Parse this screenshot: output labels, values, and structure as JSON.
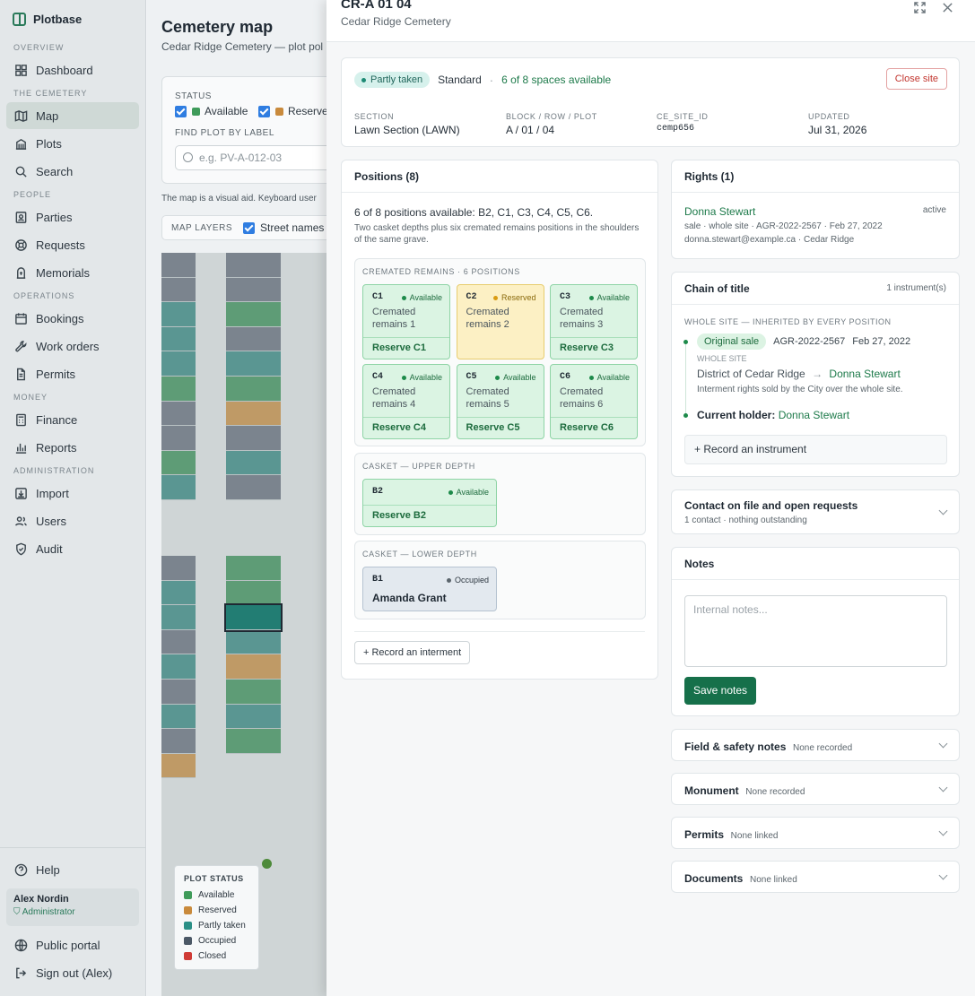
{
  "app": {
    "name": "Plotbase"
  },
  "sidebar": {
    "sections": [
      {
        "label": "OVERVIEW",
        "items": [
          {
            "label": "Dashboard",
            "icon": "grid-icon"
          }
        ]
      },
      {
        "label": "THE CEMETERY",
        "items": [
          {
            "label": "Map",
            "icon": "map-icon",
            "active": true
          },
          {
            "label": "Plots",
            "icon": "building-icon"
          },
          {
            "label": "Search",
            "icon": "search-icon"
          }
        ]
      },
      {
        "label": "PEOPLE",
        "items": [
          {
            "label": "Parties",
            "icon": "contact-icon"
          },
          {
            "label": "Requests",
            "icon": "lifebuoy-icon"
          },
          {
            "label": "Memorials",
            "icon": "memorial-icon"
          }
        ]
      },
      {
        "label": "OPERATIONS",
        "items": [
          {
            "label": "Bookings",
            "icon": "calendar-icon"
          },
          {
            "label": "Work orders",
            "icon": "wrench-icon"
          },
          {
            "label": "Permits",
            "icon": "file-icon"
          }
        ]
      },
      {
        "label": "MONEY",
        "items": [
          {
            "label": "Finance",
            "icon": "calculator-icon"
          },
          {
            "label": "Reports",
            "icon": "bar-chart-icon"
          }
        ]
      },
      {
        "label": "ADMINISTRATION",
        "items": [
          {
            "label": "Import",
            "icon": "import-icon"
          },
          {
            "label": "Users",
            "icon": "users-icon"
          },
          {
            "label": "Audit",
            "icon": "shield-icon"
          }
        ]
      }
    ],
    "help": "Help",
    "user": {
      "name": "Alex Nordin",
      "role": "Administrator"
    },
    "public_portal": "Public portal",
    "sign_out": "Sign out (Alex)"
  },
  "main": {
    "title": "Cemetery map",
    "subtitle": "Cedar Ridge Cemetery — plot pol",
    "status_label": "STATUS",
    "status_available": "Available",
    "status_reserved": "Reserve",
    "find_label": "FIND PLOT BY LABEL",
    "find_placeholder": "e.g. PV-A-012-03",
    "hint": "The map is a visual aid. Keyboard user",
    "layers_label": "MAP LAYERS",
    "layers_street": "Street names",
    "legend": {
      "title": "PLOT STATUS",
      "items": [
        {
          "label": "Available",
          "color": "#3f9b5a"
        },
        {
          "label": "Reserved",
          "color": "#c98a3c"
        },
        {
          "label": "Partly taken",
          "color": "#2a8f86"
        },
        {
          "label": "Occupied",
          "color": "#4b5866"
        },
        {
          "label": "Closed",
          "color": "#cf3b36"
        }
      ]
    }
  },
  "drawer": {
    "title": "CR-A 01 04",
    "subtitle": "Cedar Ridge Cemetery",
    "summary": {
      "status_badge": "Partly taken",
      "tier": "Standard",
      "availability": "6 of 8 spaces available",
      "close_site": "Close site",
      "section_label": "SECTION",
      "section_value": "Lawn Section (LAWN)",
      "brp_label": "BLOCK / ROW / PLOT",
      "brp_value": "A / 01 / 04",
      "ce_label": "CE_SITE_ID",
      "ce_value": "cemp656",
      "updated_label": "UPDATED",
      "updated_value": "Jul 31, 2026"
    },
    "positions": {
      "title": "Positions (8)",
      "available_text": "6 of 8 positions available: B2, C1, C3, C4, C5, C6.",
      "explain": "Two casket depths plus six cremated remains positions in the shoulders of the same grave.",
      "cremated_label": "CREMATED REMAINS · 6 POSITIONS",
      "cremated": [
        {
          "code": "C1",
          "status": "Available",
          "desc": "Cremated remains 1",
          "action": "Reserve C1"
        },
        {
          "code": "C2",
          "status": "Reserved",
          "desc": "Cremated remains 2",
          "action": ""
        },
        {
          "code": "C3",
          "status": "Available",
          "desc": "Cremated remains 3",
          "action": "Reserve C3"
        },
        {
          "code": "C4",
          "status": "Available",
          "desc": "Cremated remains 4",
          "action": "Reserve C4"
        },
        {
          "code": "C5",
          "status": "Available",
          "desc": "Cremated remains 5",
          "action": "Reserve C5"
        },
        {
          "code": "C6",
          "status": "Available",
          "desc": "Cremated remains 6",
          "action": "Reserve C6"
        }
      ],
      "upper_label": "CASKET — UPPER DEPTH",
      "upper": {
        "code": "B2",
        "status": "Available",
        "action": "Reserve B2"
      },
      "lower_label": "CASKET — LOWER DEPTH",
      "lower": {
        "code": "B1",
        "status": "Occupied",
        "name": "Amanda Grant"
      },
      "record_interment": "Record an interment"
    },
    "rights": {
      "title": "Rights (1)",
      "holder": "Donna Stewart",
      "state": "active",
      "line1": "sale · whole site · AGR-2022-2567 · Feb 27, 2022",
      "line2": "donna.stewart@example.ca · Cedar Ridge"
    },
    "chain": {
      "title": "Chain of title",
      "count": "1 instrument(s)",
      "scope_label": "WHOLE SITE — INHERITED BY EVERY POSITION",
      "badge": "Original sale",
      "ref": "AGR-2022-2567",
      "date": "Feb 27, 2022",
      "scope": "WHOLE SITE",
      "from": "District of Cedar Ridge",
      "to": "Donna Stewart",
      "note": "Interment rights sold by the City over the whole site.",
      "current_label": "Current holder:",
      "current": "Donna Stewart",
      "record_instrument": "+ Record an instrument"
    },
    "contact": {
      "title": "Contact on file and open requests",
      "sub": "1 contact · nothing outstanding"
    },
    "notes": {
      "title": "Notes",
      "placeholder": "Internal notes...",
      "save": "Save notes"
    },
    "collapsibles": [
      {
        "title": "Field & safety notes",
        "sub": "None recorded"
      },
      {
        "title": "Monument",
        "sub": "None recorded"
      },
      {
        "title": "Permits",
        "sub": "None linked"
      },
      {
        "title": "Documents",
        "sub": "None linked"
      }
    ]
  }
}
